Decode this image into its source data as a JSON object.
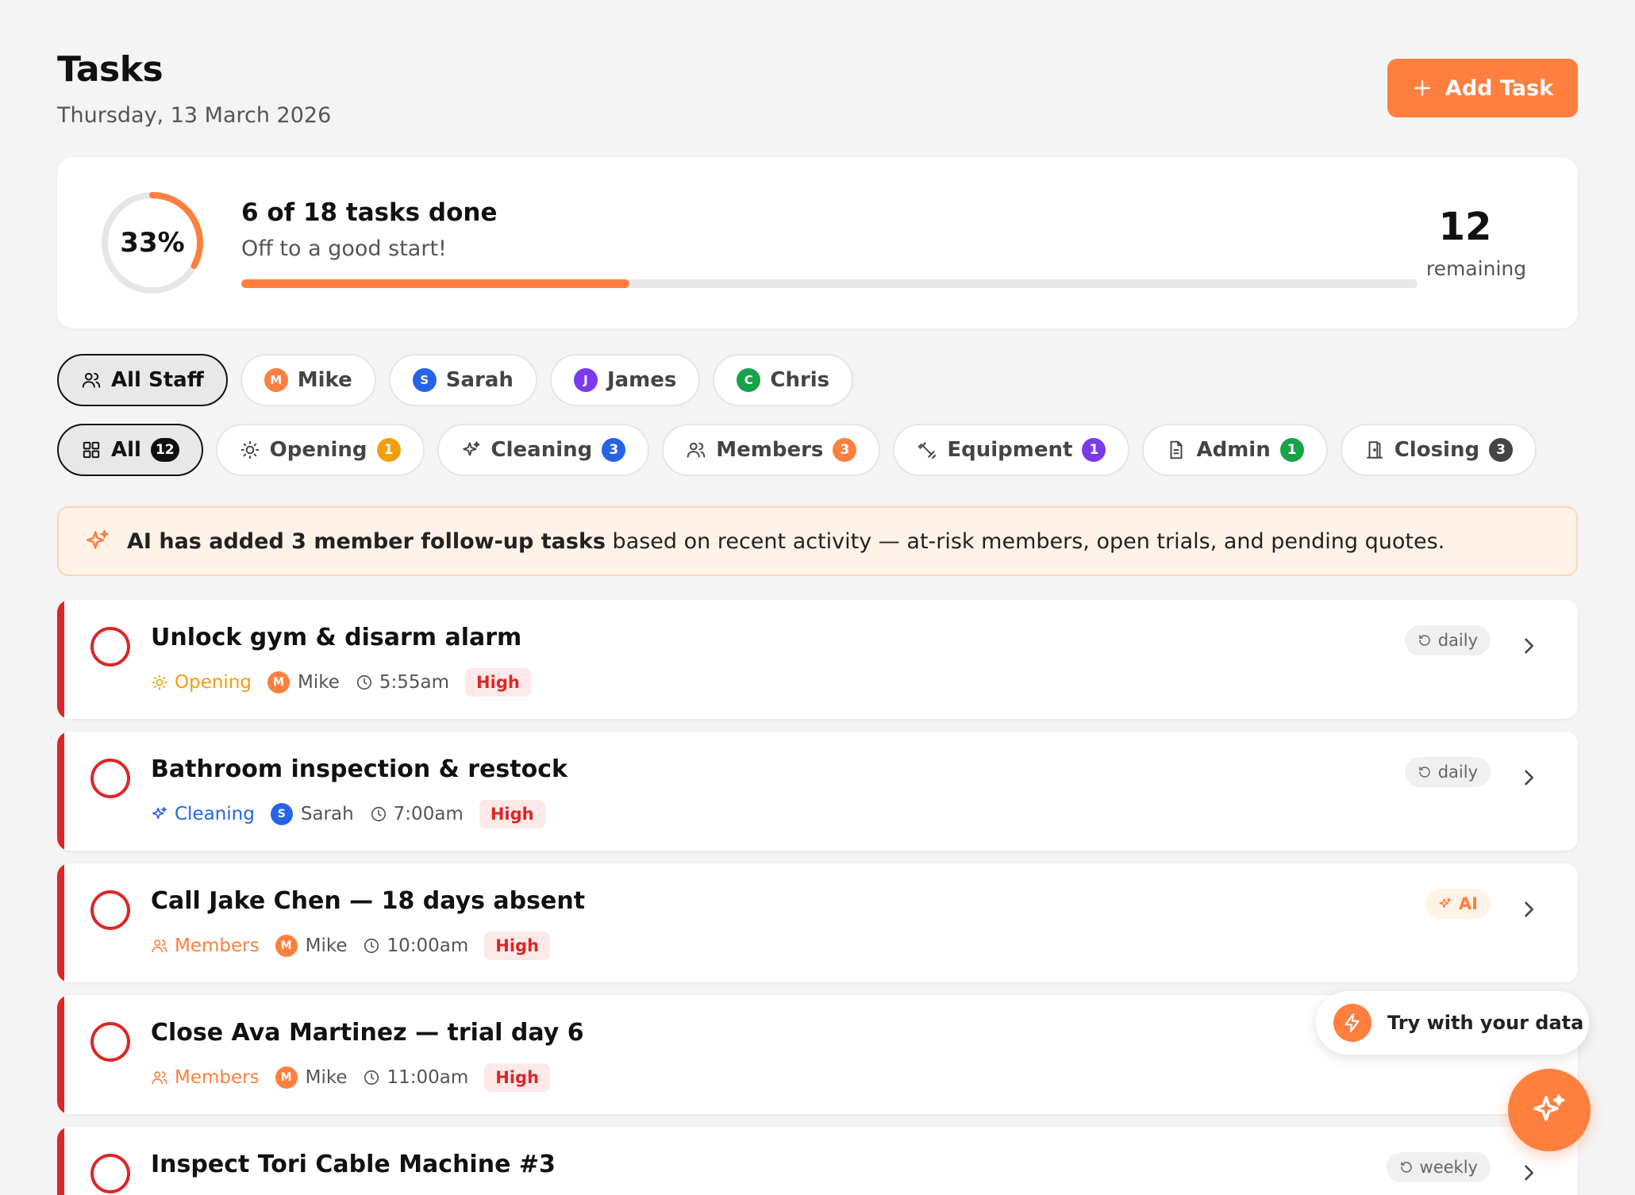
{
  "header": {
    "title": "Tasks",
    "date": "Thursday, 13 March 2026",
    "add_button_label": "Add Task"
  },
  "progress": {
    "percent_label": "33%",
    "percent_value": 33,
    "done_label": "6 of 18 tasks done",
    "message": "Off to a good start!",
    "remaining_count": "12",
    "remaining_label": "remaining"
  },
  "staff_filters": [
    {
      "label": "All Staff",
      "active": true
    },
    {
      "label": "Mike",
      "initial": "M",
      "color": "#ff7f3f"
    },
    {
      "label": "Sarah",
      "initial": "S",
      "color": "#2563eb"
    },
    {
      "label": "James",
      "initial": "J",
      "color": "#7c3aed"
    },
    {
      "label": "Chris",
      "initial": "C",
      "color": "#16a34a"
    }
  ],
  "category_filters": [
    {
      "label": "All",
      "count": "12",
      "color": "#111111",
      "icon": "grid-icon",
      "active": true
    },
    {
      "label": "Opening",
      "count": "1",
      "color": "#f59e0b",
      "icon": "sun-icon"
    },
    {
      "label": "Cleaning",
      "count": "3",
      "color": "#2563eb",
      "icon": "sparkles-icon"
    },
    {
      "label": "Members",
      "count": "3",
      "color": "#ff7f3f",
      "icon": "users-icon"
    },
    {
      "label": "Equipment",
      "count": "1",
      "color": "#7c3aed",
      "icon": "dumbbell-icon"
    },
    {
      "label": "Admin",
      "count": "1",
      "color": "#16a34a",
      "icon": "document-icon"
    },
    {
      "label": "Closing",
      "count": "3",
      "color": "#444444",
      "icon": "door-icon"
    }
  ],
  "ai_banner": {
    "bold_text": "AI has added 3 member follow-up tasks",
    "rest_text": " based on recent activity — at-risk members, open trials, and pending quotes."
  },
  "tasks": [
    {
      "title": "Unlock gym & disarm alarm",
      "category": "Opening",
      "category_color": "#f59e0b",
      "person": "Mike",
      "initial": "M",
      "person_color": "#ff7f3f",
      "time": "5:55am",
      "priority": "High",
      "tag": "daily"
    },
    {
      "title": "Bathroom inspection & restock",
      "category": "Cleaning",
      "category_color": "#2563eb",
      "person": "Sarah",
      "initial": "S",
      "person_color": "#2563eb",
      "time": "7:00am",
      "priority": "High",
      "tag": "daily"
    },
    {
      "title": "Call Jake Chen — 18 days absent",
      "category": "Members",
      "category_color": "#ff7f3f",
      "person": "Mike",
      "initial": "M",
      "person_color": "#ff7f3f",
      "time": "10:00am",
      "priority": "High",
      "tag": "AI"
    },
    {
      "title": "Close Ava Martinez — trial day 6",
      "category": "Members",
      "category_color": "#ff7f3f",
      "person": "Mike",
      "initial": "M",
      "person_color": "#ff7f3f",
      "time": "11:00am",
      "priority": "High",
      "tag": ""
    },
    {
      "title": "Inspect Tori Cable Machine #3",
      "tag": "weekly"
    }
  ],
  "floating": {
    "try_label": "Try with your data"
  },
  "colors": {
    "accent": "#ff7f3f",
    "priority_high": "#dc2626"
  }
}
